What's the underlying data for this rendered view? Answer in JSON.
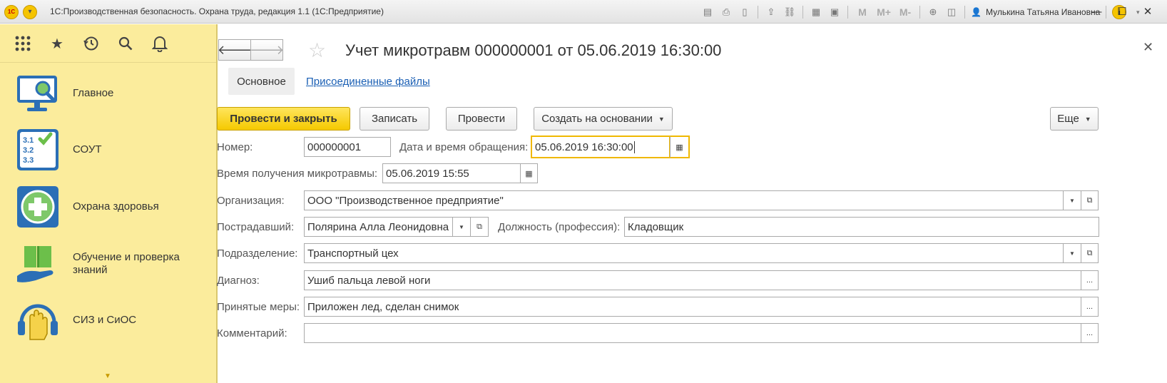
{
  "window": {
    "logo_text": "1С",
    "title": "1С:Производственная безопасность. Охрана труда, редакция 1.1  (1С:Предприятие)",
    "user": "Мулькина Татьяна Ивановна",
    "m_buttons": [
      "M",
      "M+",
      "M-"
    ]
  },
  "sidebar": {
    "items": [
      {
        "label": "Главное",
        "icon": "monitor-search-icon"
      },
      {
        "label": "СОУТ",
        "icon": "checklist-icon"
      },
      {
        "label": "Охрана здоровья",
        "icon": "medical-cross-icon"
      },
      {
        "label": "Обучение и проверка знаний",
        "icon": "book-hand-icon"
      },
      {
        "label": "СИЗ и СиОС",
        "icon": "glove-headphones-icon"
      }
    ],
    "checklist_lines": [
      "3.1",
      "3.2",
      "3.3"
    ]
  },
  "document": {
    "title": "Учет микротравм 000000001 от 05.06.2019 16:30:00",
    "tabs": {
      "main": "Основное",
      "files": "Присоединенные файлы"
    },
    "buttons": {
      "post_close": "Провести и закрыть",
      "save": "Записать",
      "post": "Провести",
      "create_based": "Создать на основании",
      "more": "Еще"
    },
    "fields": {
      "number_label": "Номер:",
      "number": "000000001",
      "appeal_dt_label": "Дата и время обращения:",
      "appeal_dt": "05.06.2019 16:30:00",
      "injury_time_label": "Время получения микротравмы:",
      "injury_time": "05.06.2019 15:55",
      "org_label": "Организация:",
      "org": "ООО \"Производственное предприятие\"",
      "victim_label": "Пострадавший:",
      "victim": "Полярина Алла  Леонидовна",
      "position_label": "Должность (профессия):",
      "position": "Кладовщик",
      "dept_label": "Подразделение:",
      "dept": "Транспортный цех",
      "diagnosis_label": "Диагноз:",
      "diagnosis": "Ушиб пальца левой ноги",
      "measures_label": "Принятые меры:",
      "measures": "Приложен лед, сделан снимок",
      "comment_label": "Комментарий:",
      "comment": ""
    }
  },
  "colors": {
    "accent": "#f5c900",
    "sidebar_bg": "#fbec9c",
    "link": "#1a5fb4",
    "icon_blue": "#2b6fb6"
  }
}
